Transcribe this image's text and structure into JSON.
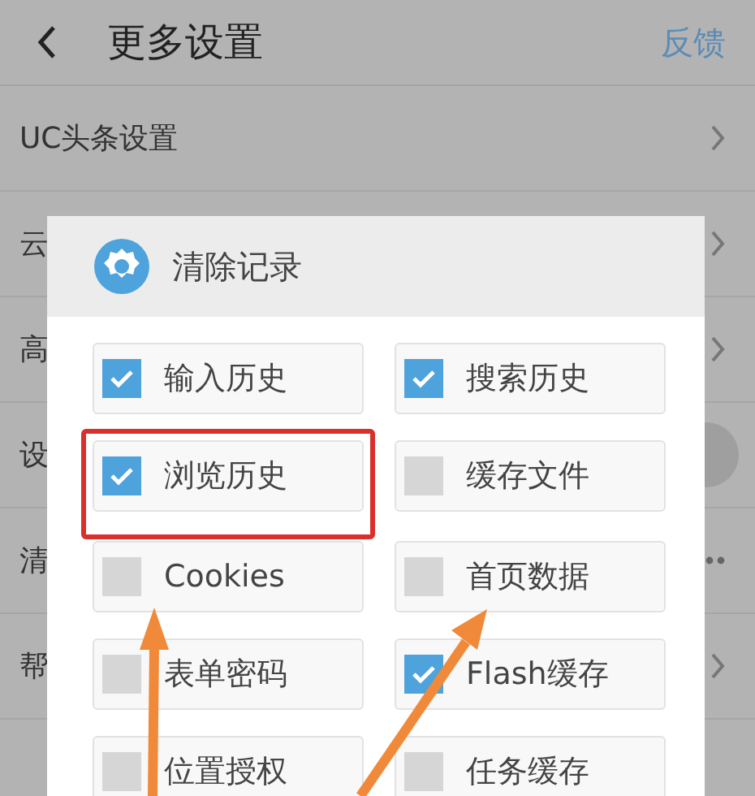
{
  "header": {
    "title": "更多设置",
    "action": "反馈"
  },
  "settings_rows": [
    {
      "label": "UC头条设置",
      "kind": "chevron"
    },
    {
      "label": "云",
      "kind": "chevron"
    },
    {
      "label": "高",
      "kind": "chevron"
    },
    {
      "label": "设",
      "kind": "toggle"
    },
    {
      "label": "清",
      "kind": "more"
    },
    {
      "label": "帮",
      "kind": "chevron"
    }
  ],
  "dialog": {
    "title": "清除记录",
    "options": [
      {
        "label": "输入历史",
        "checked": true,
        "highlighted": false
      },
      {
        "label": "搜索历史",
        "checked": true,
        "highlighted": false
      },
      {
        "label": "浏览历史",
        "checked": true,
        "highlighted": true
      },
      {
        "label": "缓存文件",
        "checked": false,
        "highlighted": false
      },
      {
        "label": "Cookies",
        "checked": false,
        "highlighted": false
      },
      {
        "label": "首页数据",
        "checked": false,
        "highlighted": false
      },
      {
        "label": "表单密码",
        "checked": false,
        "highlighted": false
      },
      {
        "label": "Flash缓存",
        "checked": true,
        "highlighted": false
      },
      {
        "label": "位置授权",
        "checked": false,
        "highlighted": false
      },
      {
        "label": "任务缓存",
        "checked": false,
        "highlighted": false
      }
    ]
  }
}
